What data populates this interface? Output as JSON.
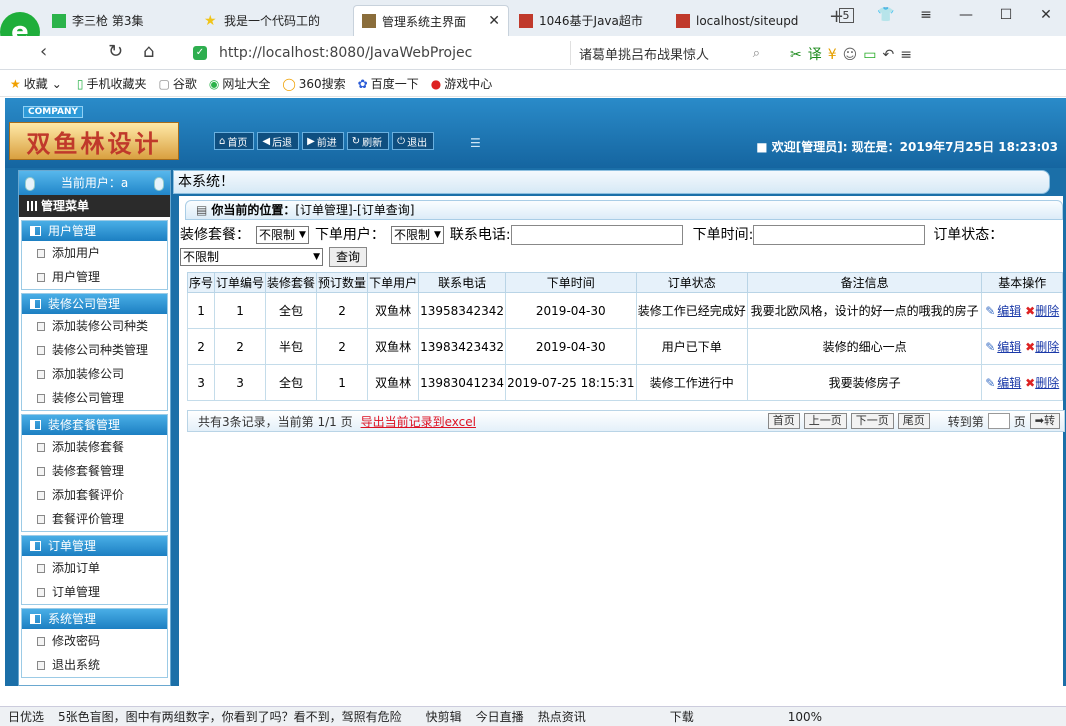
{
  "browser": {
    "tabs": [
      {
        "label": "李三枪 第3集",
        "icon_color": "#2bb34a"
      },
      {
        "label": "我是一个代码工的",
        "icon_color": "#f0c419"
      },
      {
        "label": "管理系统主界面",
        "icon_color": "#8a6d3b",
        "active": true
      },
      {
        "label": "1046基于Java超市",
        "icon_color": "#c0392b"
      },
      {
        "label": "localhost/siteupd",
        "icon_color": "#c0392b"
      }
    ],
    "tab_count": "5",
    "url": "http://localhost:8080/JavaWebProjec",
    "search_text": "诸葛单挑吕布战果惊人",
    "bookmarks": [
      "收藏",
      "手机收藏夹",
      "谷歌",
      "网址大全",
      "360搜索",
      "百度一下",
      "游戏中心"
    ]
  },
  "app": {
    "company": "COMPANY",
    "brand": "双鱼林设计",
    "top_menu": [
      "首页",
      "后退",
      "前进",
      "刷新",
      "退出"
    ],
    "welcome": "■ 欢迎[管理员]: 现在是：2019年7月25日 18:23:03",
    "current_user": "当前用户：a",
    "main_menu": "管理菜单",
    "system_banner": "本系统！",
    "menu_groups": [
      {
        "title": "用户管理",
        "items": [
          "添加用户",
          "用户管理"
        ]
      },
      {
        "title": "装修公司管理",
        "items": [
          "添加装修公司种类",
          "装修公司种类管理",
          "添加装修公司",
          "装修公司管理"
        ]
      },
      {
        "title": "装修套餐管理",
        "items": [
          "添加装修套餐",
          "装修套餐管理",
          "添加套餐评价",
          "套餐评价管理"
        ]
      },
      {
        "title": "订单管理",
        "items": [
          "添加订单",
          "订单管理"
        ]
      },
      {
        "title": "系统管理",
        "items": [
          "修改密码",
          "退出系统"
        ]
      }
    ]
  },
  "content": {
    "position_label": "你当前的位置：",
    "position_path": "[订单管理]-[订单查询]",
    "filters": {
      "package_label": "装修套餐：",
      "package_value": "不限制",
      "user_label": "下单用户：",
      "user_value": "不限制",
      "phone_label": "联系电话:",
      "time_label": "下单时间:",
      "status_label": "订单状态：",
      "status_value": "不限制",
      "query_button": "查询"
    },
    "table": {
      "headers": [
        "序号",
        "订单编号",
        "装修套餐",
        "预订数量",
        "下单用户",
        "联系电话",
        "下单时间",
        "订单状态",
        "备注信息",
        "基本操作"
      ],
      "rows": [
        [
          "1",
          "1",
          "全包",
          "2",
          "双鱼林",
          "13958342342",
          "2019-04-30",
          "装修工作已经完成好",
          "我要北欧风格，设计的好一点的哦我的房子"
        ],
        [
          "2",
          "2",
          "半包",
          "2",
          "双鱼林",
          "13983423432",
          "2019-04-30",
          "用户已下单",
          "装修的细心一点"
        ],
        [
          "3",
          "3",
          "全包",
          "1",
          "双鱼林",
          "13983041234",
          "2019-07-25 18:15:31",
          "装修工作进行中",
          "我要装修房子"
        ]
      ],
      "edit_label": "编辑",
      "delete_label": "删除"
    },
    "pager": {
      "summary": "共有3条记录，当前第 1/1 页",
      "export": "导出当前记录到excel",
      "first": "首页",
      "prev": "上一页",
      "next": "下一页",
      "last": "尾页",
      "goto": "转到第",
      "page_unit": "页",
      "go": "➡转"
    }
  },
  "statusbar": [
    "日优选",
    "5张色盲图，图中有两组数字，你看到了吗？看不到，驾照有危险",
    "快剪辑",
    "今日直播",
    "热点资讯",
    "下载",
    "100%"
  ]
}
